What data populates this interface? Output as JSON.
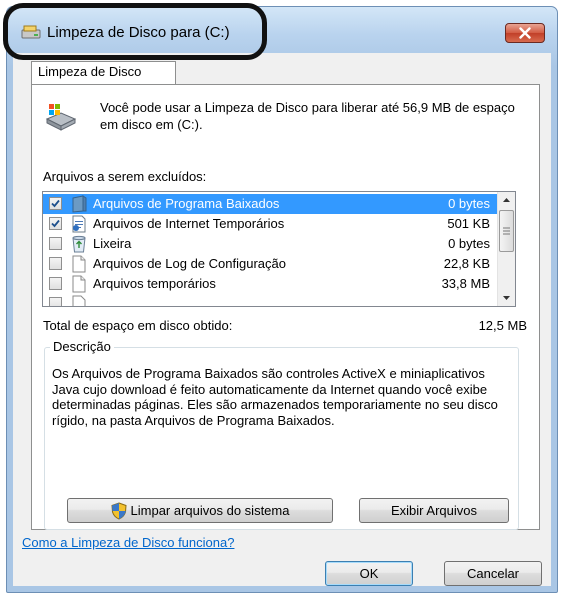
{
  "window": {
    "title": "Limpeza de Disco para  (C:)"
  },
  "tab": {
    "label": "Limpeza de Disco"
  },
  "intro_text": "Você pode usar a Limpeza de Disco para liberar até 56,9 MB de espaço em disco em  (C:).",
  "files_section_label": "Arquivos a serem excluídos:",
  "files": [
    {
      "name": "Arquivos de Programa Baixados",
      "size": "0 bytes",
      "checked": true,
      "selected": true,
      "icon": "folder-icon"
    },
    {
      "name": "Arquivos de Internet Temporários",
      "size": "501 KB",
      "checked": true,
      "selected": false,
      "icon": "document-lock-icon"
    },
    {
      "name": "Lixeira",
      "size": "0 bytes",
      "checked": false,
      "selected": false,
      "icon": "recycle-bin-icon"
    },
    {
      "name": "Arquivos de Log de Configuração",
      "size": "22,8 KB",
      "checked": false,
      "selected": false,
      "icon": "blank-file-icon"
    },
    {
      "name": "Arquivos temporários",
      "size": "33,8 MB",
      "checked": false,
      "selected": false,
      "icon": "blank-file-icon"
    }
  ],
  "total": {
    "label": "Total de espaço em disco obtido:",
    "value": "12,5 MB"
  },
  "description": {
    "legend": "Descrição",
    "text": "Os Arquivos de Programa Baixados são controles ActiveX e miniaplicativos Java cujo download é feito automaticamente da Internet quando você exibe determinadas páginas. Eles são armazenados temporariamente no seu disco rígido, na pasta Arquivos de Programa Baixados."
  },
  "buttons": {
    "cleanup_system": "Limpar arquivos do sistema",
    "view_files": "Exibir Arquivos",
    "ok": "OK",
    "cancel": "Cancelar"
  },
  "help_link": "Como a Limpeza de Disco funciona?",
  "colors": {
    "selection": "#3399ff",
    "link": "#0066cc",
    "close_button": "#c94a32"
  }
}
